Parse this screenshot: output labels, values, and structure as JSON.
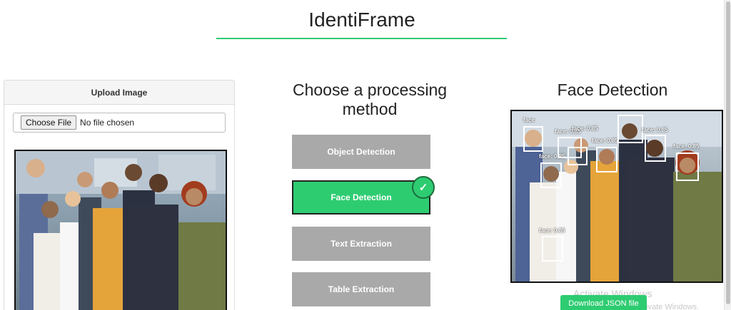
{
  "app": {
    "title": "IdentiFrame"
  },
  "upload": {
    "header": "Upload Image",
    "choose_button": "Choose File",
    "file_status": "No file chosen"
  },
  "methods": {
    "title": "Choose a processing method",
    "options": [
      {
        "label": "Object Detection",
        "selected": false
      },
      {
        "label": "Face Detection",
        "selected": true
      },
      {
        "label": "Text Extraction",
        "selected": false
      },
      {
        "label": "Table Extraction",
        "selected": false
      }
    ],
    "check_glyph": "✓"
  },
  "result": {
    "title": "Face Detection",
    "download_button": "Download JSON file",
    "face_labels": [
      "face",
      "face: 0.85",
      "face: 0.85",
      "face: 0.85",
      "face: 0.85",
      "face: 0.85",
      "face: 0.85",
      "face: 0.85",
      "face: 0.85",
      "face: 0.85"
    ]
  },
  "os_watermark": {
    "line1": "Activate Windows",
    "line2": "tivate Windows."
  },
  "colors": {
    "accent": "#2ecc71",
    "button_gray": "#a9a9a9",
    "text": "#222222"
  }
}
